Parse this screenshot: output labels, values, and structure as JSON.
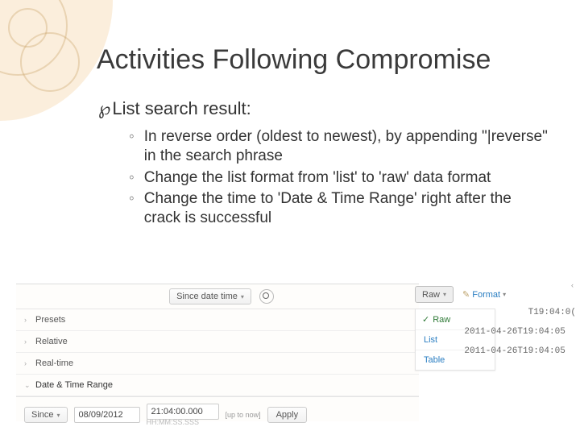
{
  "title": "Activities Following Compromise",
  "bullet1": "List search result:",
  "sub_bullets": [
    "In reverse order (oldest to newest), by appending \"|reverse\" in the search phrase",
    "Change the list format from 'list' to 'raw' data format",
    "Change the time to 'Date & Time Range' right after the crack is successful"
  ],
  "toolbar": {
    "time_selector": "Since date time"
  },
  "side_panel": {
    "rows": [
      "Presets",
      "Relative",
      "Real-time",
      "Date & Time Range"
    ]
  },
  "controls": {
    "since_label": "Since",
    "date_value": "08/09/2012",
    "time_value": "21:04:00.000",
    "hint_top": "[up to now]",
    "hint_bottom": "HH:MM:SS.SSS",
    "apply": "Apply"
  },
  "right": {
    "raw_label": "Raw",
    "format_label": "Format",
    "dropdown": [
      "Raw",
      "List",
      "Table"
    ]
  },
  "timestamps": [
    "            T19:04:0(",
    "2011-04-26T19:04:05",
    "2011-04-26T19:04:05"
  ]
}
